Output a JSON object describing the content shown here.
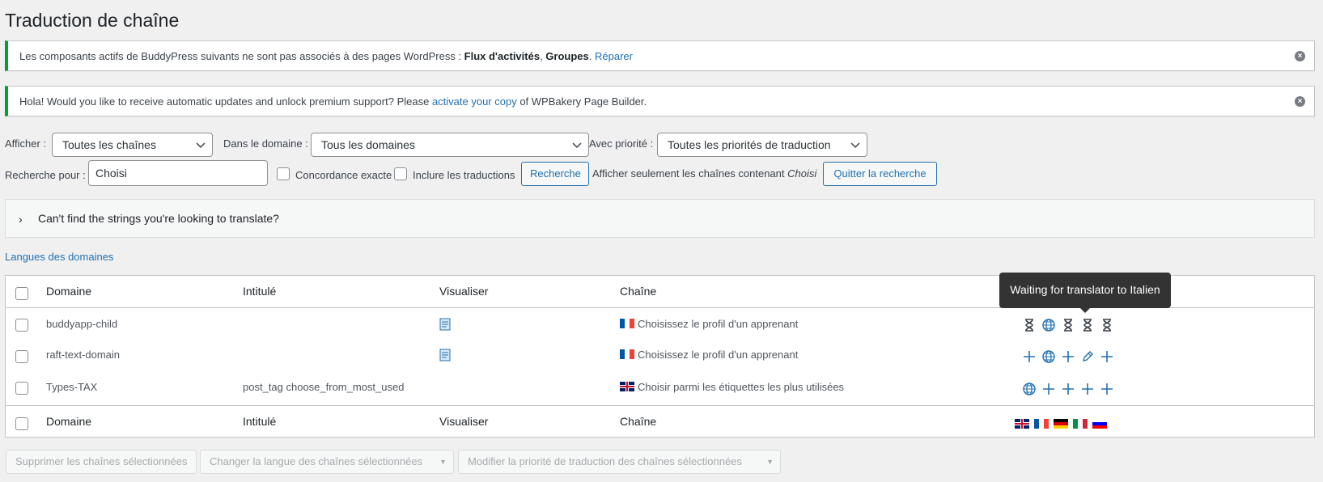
{
  "page": {
    "title": "Traduction de chaîne"
  },
  "notices": [
    {
      "text_before": "Les composants actifs de BuddyPress suivants ne sont pas associés à des pages WordPress : ",
      "bold1": "Flux d'activités",
      "sep": ", ",
      "bold2": "Groupes",
      "after": ". ",
      "link": "Réparer"
    },
    {
      "text_before": "Hola! Would you like to receive automatic updates and unlock premium support? Please ",
      "link": "activate your copy",
      "after": " of WPBakery Page Builder."
    }
  ],
  "filters": {
    "show_label": "Afficher :",
    "show_value": "Toutes les chaînes",
    "domain_label": "Dans le domaine :",
    "domain_value": "Tous les domaines",
    "priority_label": "Avec priorité :",
    "priority_value": "Toutes les priorités de traduction",
    "search_label": "Recherche pour :",
    "search_value": "Choisi",
    "exact_label": "Concordance exacte",
    "include_label": "Inclure les traductions",
    "search_button": "Recherche",
    "showing_text": "Afficher seulement les chaînes contenant",
    "showing_term": "Choisi",
    "exit_button": "Quitter la recherche"
  },
  "accordion": {
    "label": "Can't find the strings you're looking to translate?"
  },
  "domain_languages_link": "Langues des domaines",
  "table": {
    "columns": [
      "Domaine",
      "Intitulé",
      "Visualiser",
      "Chaîne"
    ],
    "rows": [
      {
        "domain": "buddyapp-child",
        "name": "",
        "view": "document-icon",
        "flag": "fr",
        "string": "Choisissez le profil d'un apprenant",
        "status": [
          "hourglass-icon",
          "globe-icon",
          "hourglass-icon",
          "hourglass-icon",
          "hourglass-icon"
        ]
      },
      {
        "domain": "raft-text-domain",
        "name": "",
        "view": "document-icon",
        "flag": "fr",
        "string": "Choisissez le profil d'un apprenant",
        "status": [
          "plus-icon",
          "globe-icon",
          "plus-icon",
          "pencil-icon",
          "plus-icon"
        ]
      },
      {
        "domain": "Types-TAX",
        "name": "post_tag choose_from_most_used",
        "view": "",
        "flag": "uk",
        "string": "Choisir parmi les étiquettes les plus utilisées",
        "status": [
          "globe-icon",
          "plus-icon",
          "plus-icon",
          "plus-icon",
          "plus-icon"
        ]
      }
    ],
    "language_flags": [
      "uk",
      "fr",
      "de",
      "it",
      "si"
    ]
  },
  "tooltip": "Waiting for translator to Italien",
  "bulk_actions": {
    "delete": "Supprimer les chaînes sélectionnées",
    "change_language": "Changer la langue des chaînes sélectionnées",
    "change_priority": "Modifier la priorité de traduction des chaînes sélectionnées"
  },
  "colors": {
    "accent": "#2271b1",
    "notice_border": "#00a32a",
    "tooltip_bg": "#333333"
  }
}
